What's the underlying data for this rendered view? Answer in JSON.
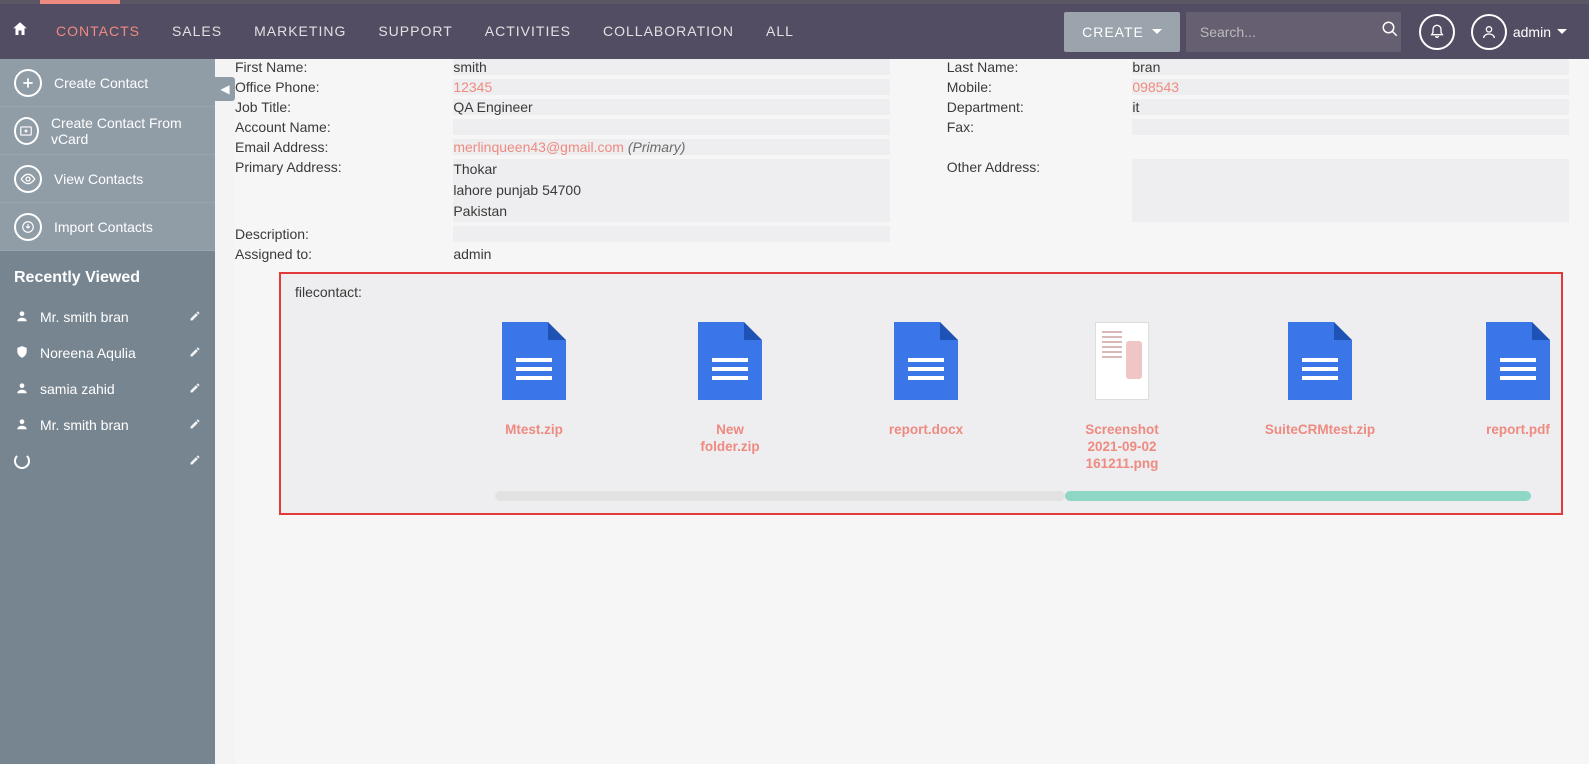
{
  "nav": {
    "items": [
      "CONTACTS",
      "SALES",
      "MARKETING",
      "SUPPORT",
      "ACTIVITIES",
      "COLLABORATION",
      "ALL"
    ],
    "active": 0
  },
  "topbar": {
    "create_label": "CREATE",
    "search_placeholder": "Search...",
    "user_name": "admin"
  },
  "sidebar": {
    "actions": [
      {
        "icon": "plus",
        "label": "Create Contact"
      },
      {
        "icon": "vcard",
        "label": "Create Contact From vCard"
      },
      {
        "icon": "eye",
        "label": "View Contacts"
      },
      {
        "icon": "download",
        "label": "Import Contacts"
      }
    ],
    "recent_title": "Recently Viewed",
    "recent": [
      {
        "icon": "person",
        "name": "Mr. smith bran"
      },
      {
        "icon": "shield",
        "name": "Noreena Aqulia"
      },
      {
        "icon": "person",
        "name": "samia zahid"
      },
      {
        "icon": "person",
        "name": "Mr. smith bran"
      },
      {
        "icon": "spinner",
        "name": ""
      }
    ]
  },
  "detail": {
    "rows": [
      {
        "l1": "First Name:",
        "v1": "smith",
        "l2": "Last Name:",
        "v2": "bran"
      },
      {
        "l1": "Office Phone:",
        "v1": "12345",
        "link1": true,
        "l2": "Mobile:",
        "v2": "098543",
        "link2": true
      },
      {
        "l1": "Job Title:",
        "v1": "QA Engineer",
        "l2": "Department:",
        "v2": "it"
      },
      {
        "l1": "Account Name:",
        "v1": "",
        "l2": "Fax:",
        "v2": ""
      },
      {
        "l1": "Email Address:",
        "v1_email": "merlinqueen43@gmail.com",
        "v1_suffix": "(Primary)",
        "wide": true
      },
      {
        "l1": "Primary Address:",
        "v1_lines": [
          "Thokar",
          "lahore punjab   54700",
          "Pakistan"
        ],
        "l2": "Other Address:",
        "v2": ""
      },
      {
        "l1": "Description:",
        "v1": "",
        "wide": true
      },
      {
        "l1": "Assigned to:",
        "v1": "admin",
        "wide_plain": true
      }
    ],
    "file_label": "filecontact:",
    "files": [
      {
        "name": "Mtest.zip",
        "type": "doc"
      },
      {
        "name": "New folder.zip",
        "type": "doc"
      },
      {
        "name": "report.docx",
        "type": "doc"
      },
      {
        "name": "Screenshot 2021-09-02 161211.png",
        "type": "img"
      },
      {
        "name": "SuiteCRMtest.zip",
        "type": "doc"
      },
      {
        "name": "report.pdf",
        "type": "doc"
      }
    ]
  }
}
